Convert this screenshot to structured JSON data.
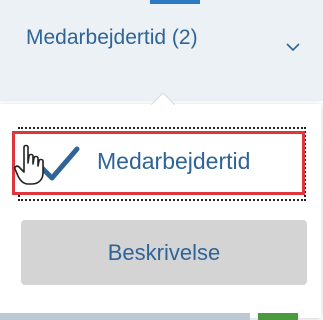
{
  "select": {
    "label": "Medarbejdertid (2)",
    "icon": "chevron-down-icon"
  },
  "popover": {
    "options": [
      {
        "label": "Medarbejdertid",
        "selected": true,
        "icon": "checkmark-icon"
      }
    ],
    "description_button": "Beskrivelse"
  },
  "colors": {
    "text_blue": "#2f6497",
    "header_bg": "#ecf1f6",
    "highlight_red": "#e0353d",
    "button_gray": "#d4d4d4",
    "accent_blue": "#2c79c4",
    "accent_green": "#4a9a3e"
  }
}
